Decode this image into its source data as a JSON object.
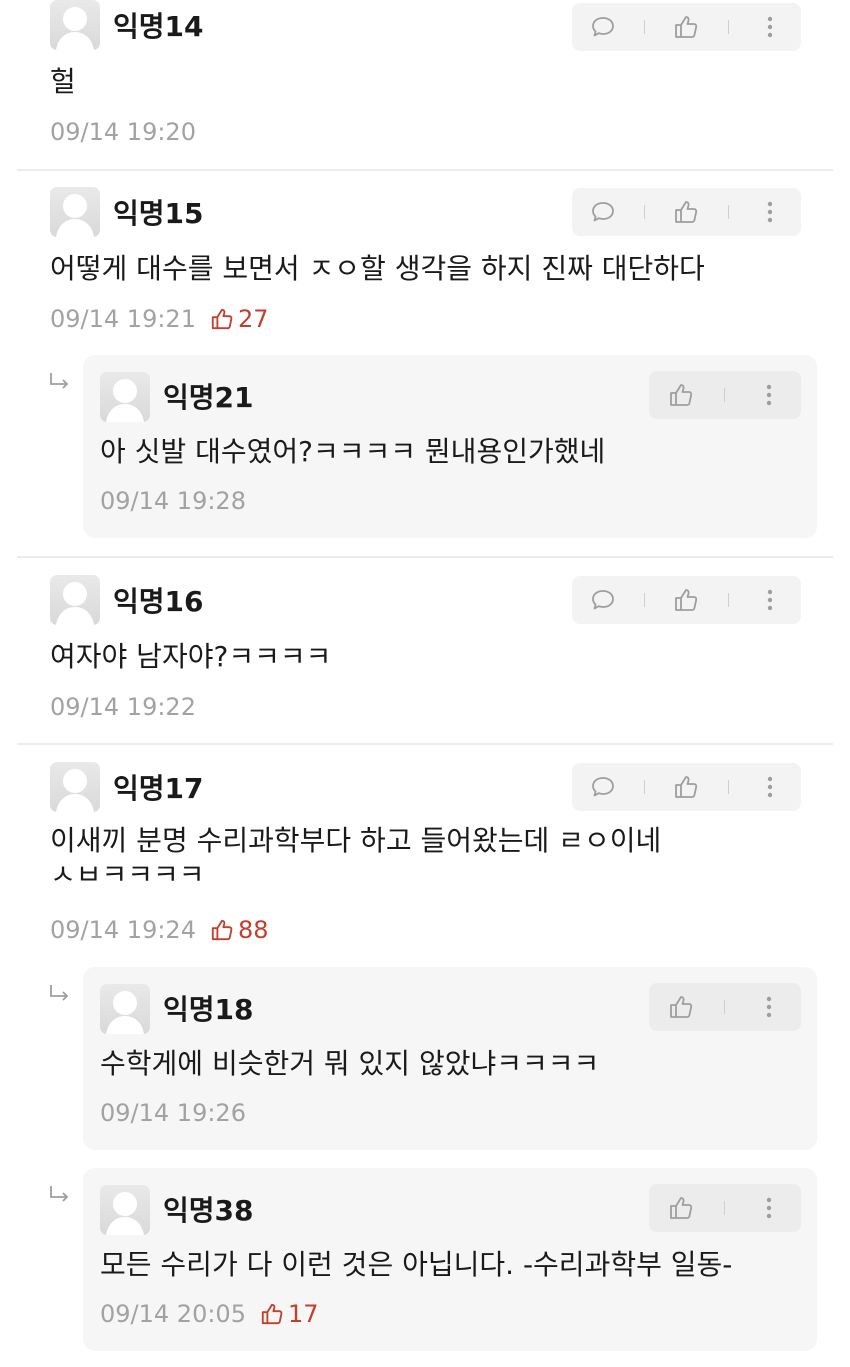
{
  "comments": [
    {
      "author": "익명14",
      "text": [
        "헐"
      ],
      "time": "09/14 19:20",
      "votes": null,
      "replies": []
    },
    {
      "author": "익명15",
      "text": [
        "어떻게 대수를 보면서 ㅈㅇ할 생각을 하지 진짜 대단하다"
      ],
      "time": "09/14 19:21",
      "votes": "27",
      "replies": [
        {
          "author": "익명21",
          "text": [
            "아 싯발 대수였어?ㅋㅋㅋㅋ 뭔내용인가했네"
          ],
          "time": "09/14 19:28",
          "votes": null
        }
      ]
    },
    {
      "author": "익명16",
      "text": [
        "여자야 남자야?ㅋㅋㅋㅋ"
      ],
      "time": "09/14 19:22",
      "votes": null,
      "replies": []
    },
    {
      "author": "익명17",
      "text": [
        "이새끼 분명 수리과학부다 하고 들어왔는데 ㄹㅇ이네",
        "ㅅㅂㅋㅋㅋㅋ"
      ],
      "time": "09/14 19:24",
      "votes": "88",
      "replies": [
        {
          "author": "익명18",
          "text": [
            "수학게에 비슷한거 뭐 있지 않았냐ㅋㅋㅋㅋ"
          ],
          "time": "09/14 19:26",
          "votes": null
        },
        {
          "author": "익명38",
          "text": [
            "모든 수리가 다 이런 것은 아닙니다. -수리과학부 일동-"
          ],
          "time": "09/14 20:05",
          "votes": "17"
        }
      ]
    }
  ],
  "icons": {
    "reply": "speech-bubble-icon",
    "like": "thumbs-up-icon",
    "more": "vertical-dots-icon",
    "vote": "thumbs-up-icon",
    "reply_arrow": "reply-arrow-icon",
    "avatar": "default-avatar-icon"
  },
  "colors": {
    "vote": "#c43e2b",
    "meta": "#a2a2a2",
    "reply_bg": "#f6f6f6",
    "action_bg": "#f3f3f3"
  }
}
